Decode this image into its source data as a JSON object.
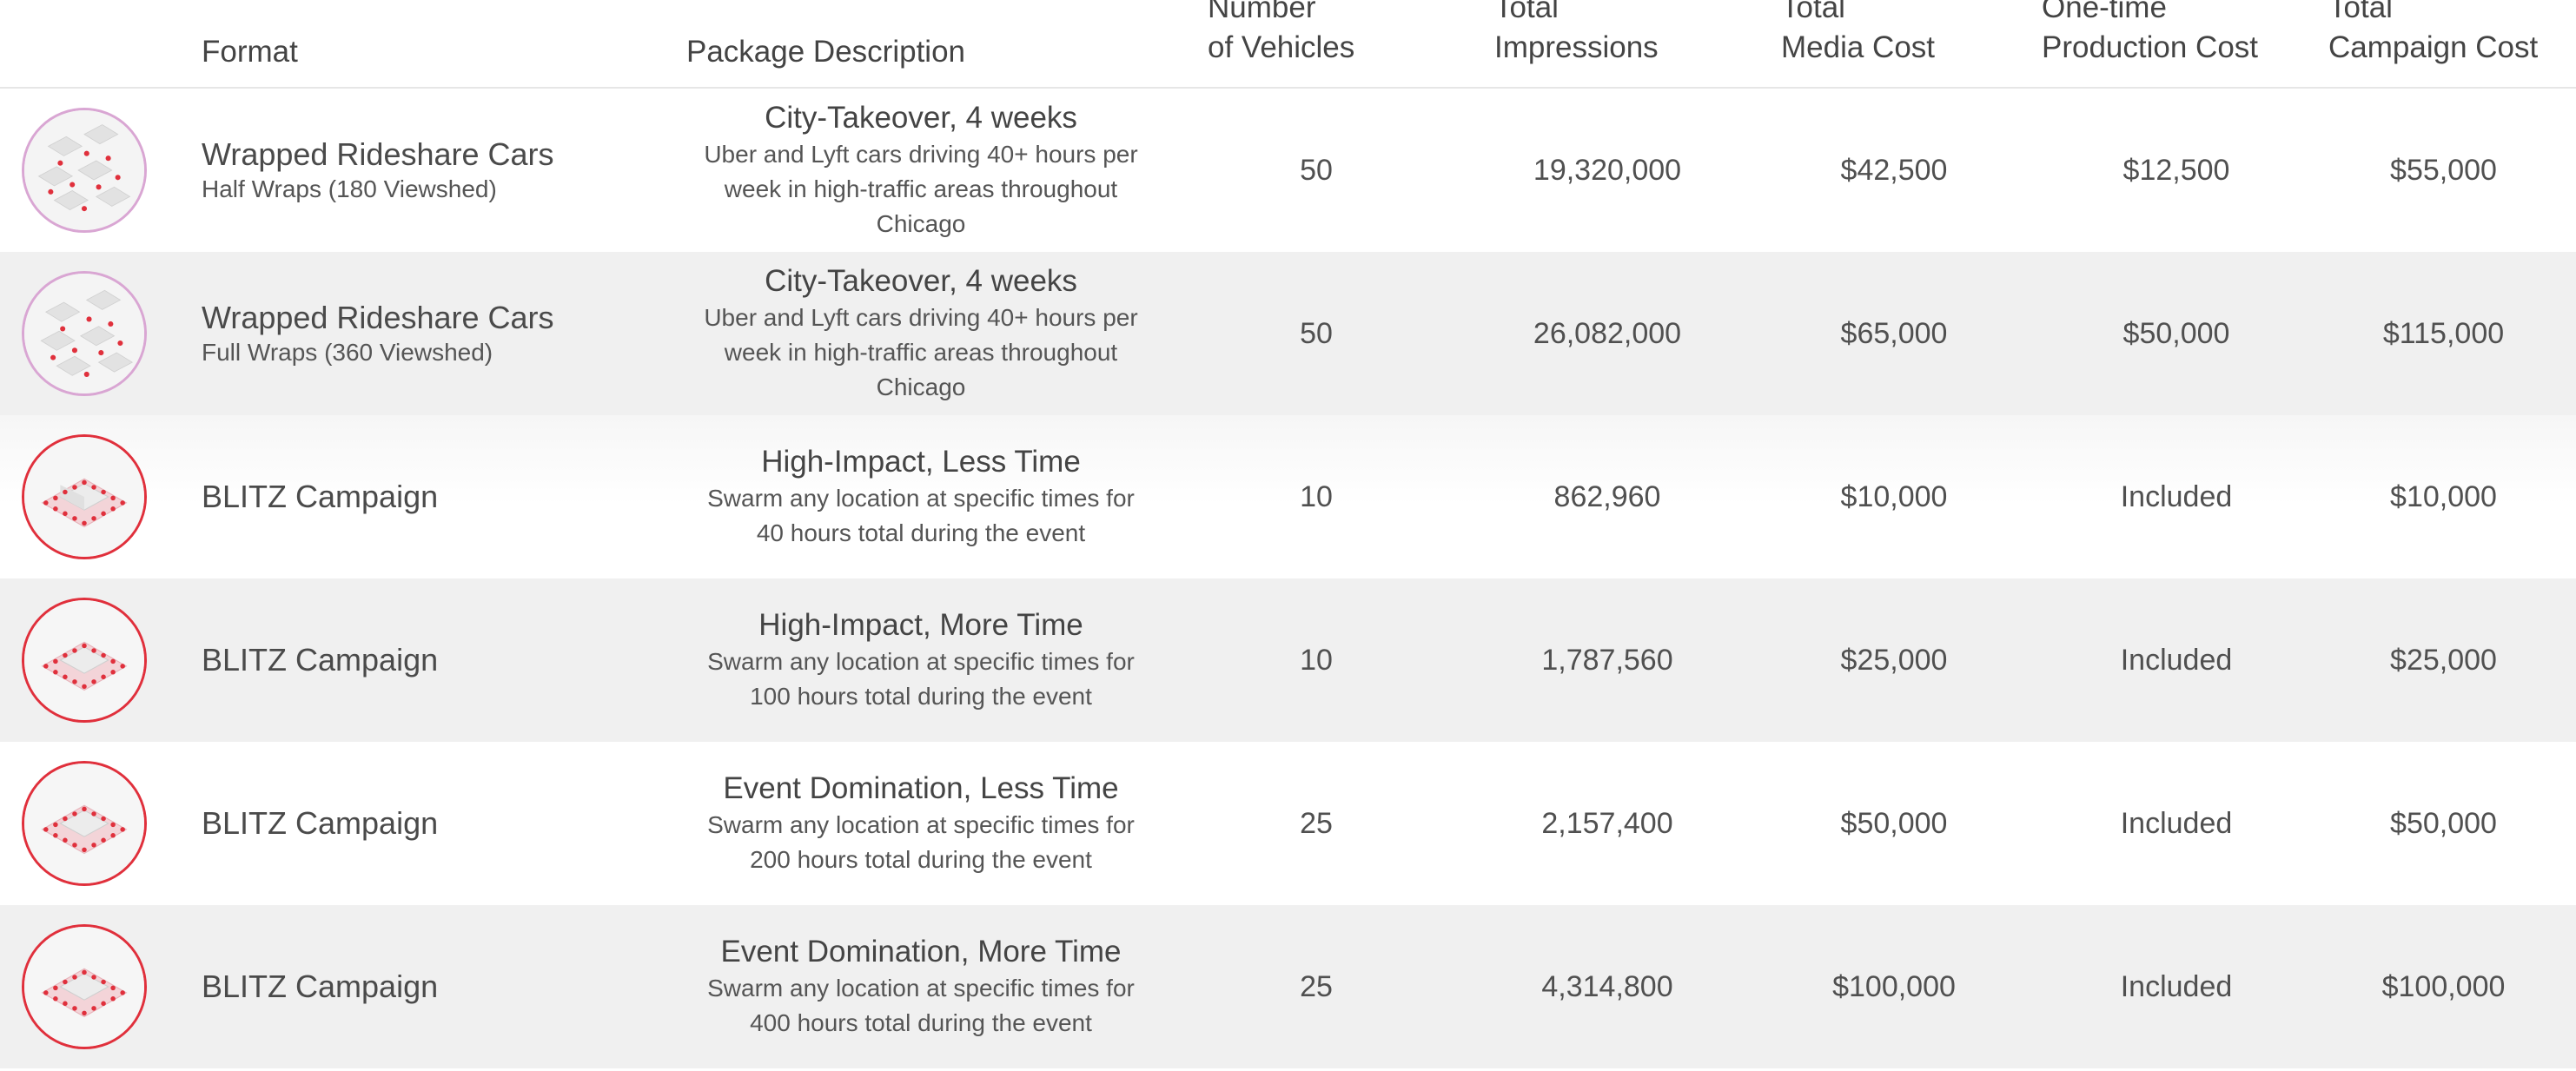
{
  "header": {
    "format": "Format",
    "package": "Package Description",
    "vehicles_1": "Number",
    "vehicles_2": "of Vehicles",
    "impressions_1": "Total",
    "impressions_2": "Impressions",
    "media_1": "Total",
    "media_2": "Media Cost",
    "production_1": "One-time",
    "production_2": "Production Cost",
    "campaign_1": "Total",
    "campaign_2": "Campaign Cost"
  },
  "rows": [
    {
      "icon": "wrapped-car-map-icon",
      "format": "Wrapped Rideshare Cars",
      "format_sub": "Half Wraps (180 Viewshed)",
      "package_title": "City-Takeover, 4 weeks",
      "package_desc_1": "Uber and Lyft cars driving 40+ hours per",
      "package_desc_2": "week in high-traffic areas throughout",
      "package_desc_3": "Chicago",
      "vehicles": "50",
      "impressions": "19,320,000",
      "media_cost": "$42,500",
      "production_cost": "$12,500",
      "campaign_cost": "$55,000"
    },
    {
      "icon": "wrapped-car-map-icon",
      "format": "Wrapped Rideshare Cars",
      "format_sub": "Full Wraps (360 Viewshed)",
      "package_title": "City-Takeover, 4 weeks",
      "package_desc_1": "Uber and Lyft cars driving 40+ hours per",
      "package_desc_2": "week in high-traffic areas throughout",
      "package_desc_3": "Chicago",
      "vehicles": "50",
      "impressions": "26,082,000",
      "media_cost": "$65,000",
      "production_cost": "$50,000",
      "campaign_cost": "$115,000"
    },
    {
      "icon": "blitz-swarm-icon",
      "format": "BLITZ Campaign",
      "format_sub": "",
      "package_title": "High-Impact, Less Time",
      "package_desc_1": "Swarm any location at specific times for",
      "package_desc_2": "40 hours total during the event",
      "package_desc_3": "",
      "vehicles": "10",
      "impressions": "862,960",
      "media_cost": "$10,000",
      "production_cost": "Included",
      "campaign_cost": "$10,000"
    },
    {
      "icon": "blitz-swarm-icon",
      "format": "BLITZ Campaign",
      "format_sub": "",
      "package_title": "High-Impact, More Time",
      "package_desc_1": "Swarm any location at specific times for",
      "package_desc_2": "100 hours total during the event",
      "package_desc_3": "",
      "vehicles": "10",
      "impressions": "1,787,560",
      "media_cost": "$25,000",
      "production_cost": "Included",
      "campaign_cost": "$25,000"
    },
    {
      "icon": "blitz-swarm-icon",
      "format": "BLITZ Campaign",
      "format_sub": "",
      "package_title": "Event Domination, Less Time",
      "package_desc_1": "Swarm any location at specific times for",
      "package_desc_2": "200 hours total during the event",
      "package_desc_3": "",
      "vehicles": "25",
      "impressions": "2,157,400",
      "media_cost": "$50,000",
      "production_cost": "Included",
      "campaign_cost": "$50,000"
    },
    {
      "icon": "blitz-swarm-icon",
      "format": "BLITZ Campaign",
      "format_sub": "",
      "package_title": "Event Domination, More Time",
      "package_desc_1": "Swarm any location at specific times for",
      "package_desc_2": "400 hours total during the event",
      "package_desc_3": "",
      "vehicles": "25",
      "impressions": "4,314,800",
      "media_cost": "$100,000",
      "production_cost": "Included",
      "campaign_cost": "$100,000"
    }
  ],
  "colors": {
    "pink_ring": "#d9a6d3",
    "red_ring": "#e0303c",
    "row_shade": "#f0f0f0"
  }
}
